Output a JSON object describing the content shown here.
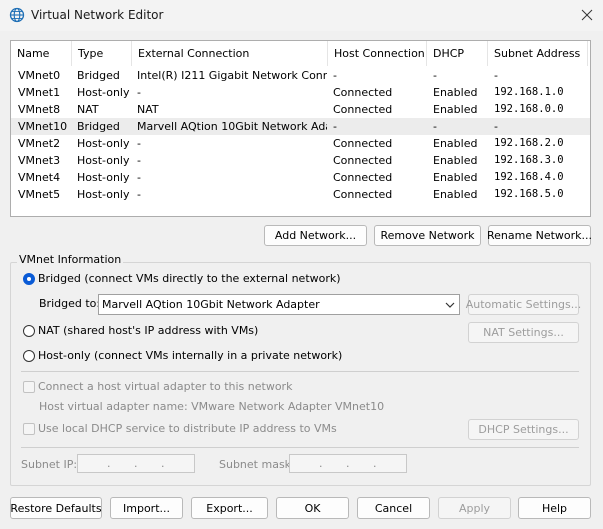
{
  "window": {
    "title": "Virtual Network Editor"
  },
  "table": {
    "headers": [
      "Name",
      "Type",
      "External Connection",
      "Host Connection",
      "DHCP",
      "Subnet Address"
    ],
    "rows": [
      [
        "VMnet0",
        "Bridged",
        "Intel(R) I211 Gigabit Network Conn...",
        "-",
        "-",
        "-"
      ],
      [
        "VMnet1",
        "Host-only",
        "-",
        "Connected",
        "Enabled",
        "192.168.1.0"
      ],
      [
        "VMnet8",
        "NAT",
        "NAT",
        "Connected",
        "Enabled",
        "192.168.0.0"
      ],
      [
        "VMnet10",
        "Bridged",
        "Marvell AQtion 10Gbit Network Ada...",
        "-",
        "-",
        "-"
      ],
      [
        "VMnet2",
        "Host-only",
        "-",
        "Connected",
        "Enabled",
        "192.168.2.0"
      ],
      [
        "VMnet3",
        "Host-only",
        "-",
        "Connected",
        "Enabled",
        "192.168.3.0"
      ],
      [
        "VMnet4",
        "Host-only",
        "-",
        "Connected",
        "Enabled",
        "192.168.4.0"
      ],
      [
        "VMnet5",
        "Host-only",
        "-",
        "Connected",
        "Enabled",
        "192.168.5.0"
      ]
    ],
    "selected_row": "VMnet10"
  },
  "network_buttons": {
    "add": "Add Network...",
    "remove": "Remove Network",
    "rename": "Rename Network..."
  },
  "vmnet_info": {
    "legend": "VMnet Information",
    "bridged_label": "Bridged (connect VMs directly to the external network)",
    "bridged_to_label": "Bridged to:",
    "bridged_to_value": "Marvell AQtion 10Gbit Network Adapter",
    "automatic_settings": "Automatic Settings...",
    "nat_label": "NAT (shared host's IP address with VMs)",
    "nat_settings": "NAT Settings...",
    "hostonly_label": "Host-only (connect VMs internally in a private network)",
    "selected_mode": "Bridged",
    "connect_adapter_label": "Connect a host virtual adapter to this network",
    "adapter_name_label": "Host virtual adapter name: VMware Network Adapter VMnet10",
    "dhcp_label": "Use local DHCP service to distribute IP address to VMs",
    "dhcp_settings": "DHCP Settings...",
    "subnet_ip_label": "Subnet IP:",
    "subnet_mask_label": "Subnet mask:"
  },
  "footer": {
    "restore": "Restore Defaults",
    "import": "Import...",
    "export": "Export...",
    "ok": "OK",
    "cancel": "Cancel",
    "apply": "Apply",
    "help": "Help"
  },
  "colors": {
    "accent": "#0a5bd6",
    "selected_row": "#ececec",
    "disabled_text": "#8b8b8b"
  }
}
